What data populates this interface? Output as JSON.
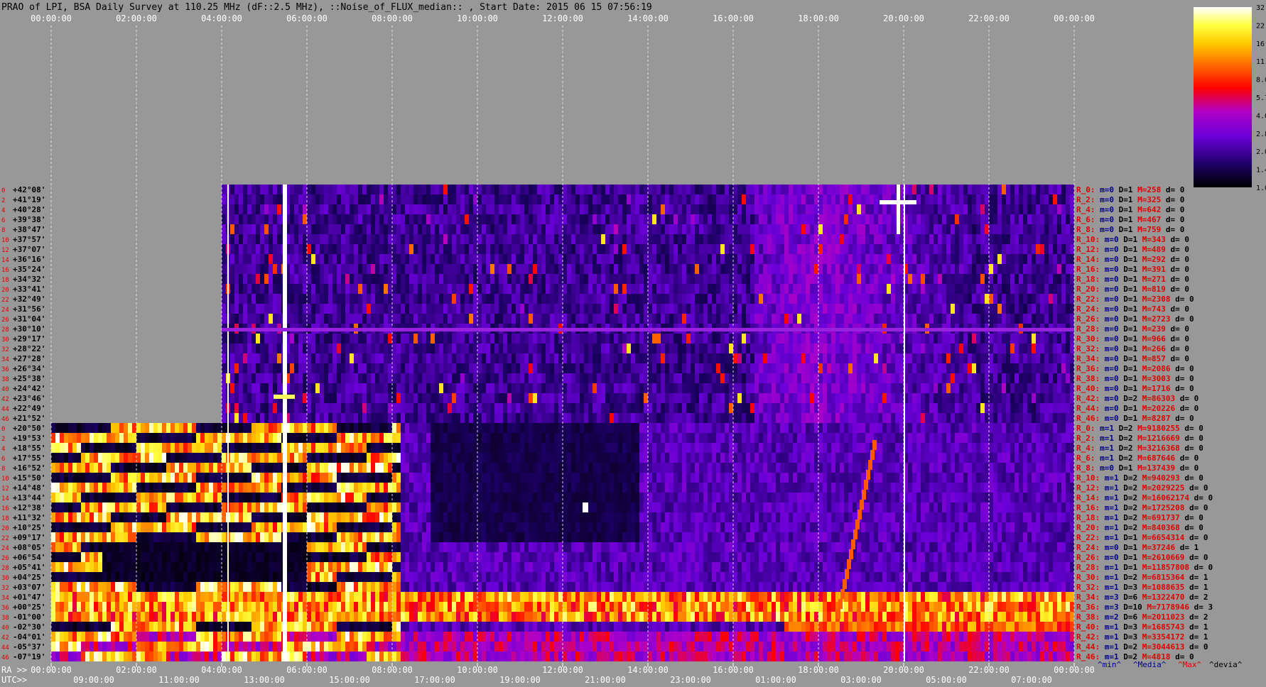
{
  "title": "PRAO of LPI, BSA Daily Survey at 110.25 MHz (dF::2.5 MHz), ::Noise_of_FLUX_median:: , Start Date: 2015 06 15 07:56:19",
  "colors": {
    "background": "#989898",
    "label_blue": "#00008b",
    "label_red": "#e00000",
    "label_black": "#000000"
  },
  "chart_data": {
    "type": "heatmap",
    "colormap": "gnuplot-like (black-blue-purple-red-orange-yellow-white)",
    "top_axis_ticks": [
      "00:00:00",
      "02:00:00",
      "04:00:00",
      "06:00:00",
      "08:00:00",
      "10:00:00",
      "12:00:00",
      "14:00:00",
      "16:00:00",
      "18:00:00",
      "20:00:00",
      "22:00:00",
      "00:00:00"
    ],
    "bottom_axis": {
      "ra_prefix": "RA >>",
      "ra_ticks": [
        "00:00:00",
        "02:00:00",
        "04:00:00",
        "06:00:00",
        "08:00:00",
        "10:00:00",
        "12:00:00",
        "14:00:00",
        "16:00:00",
        "18:00:00",
        "20:00:00",
        "22:00:00",
        "00:00:00"
      ],
      "utc_prefix": "UTC>>",
      "utc_ticks": [
        "09:00:00",
        "11:00:00",
        "13:00:00",
        "15:00:00",
        "17:00:00",
        "19:00:00",
        "21:00:00",
        "23:00:00",
        "01:00:00",
        "03:00:00",
        "05:00:00",
        "07:00:00"
      ]
    },
    "colorbar": {
      "ticks": [
        "32.0",
        "22.6",
        "16.0",
        "11.3",
        "8.0",
        "5.7",
        "4.0",
        "2.8",
        "2.0",
        "1.4",
        "1.0"
      ]
    },
    "declinations_upper": [
      "+42°08'",
      "+41°19'",
      "+40°28'",
      "+39°38'",
      "+38°47'",
      "+37°57'",
      "+37°07'",
      "+36°16'",
      "+35°24'",
      "+34°32'",
      "+33°41'",
      "+32°49'",
      "+31°56'",
      "+31°04'",
      "+30°10'",
      "+29°17'",
      "+28°22'",
      "+27°28'",
      "+26°34'",
      "+25°38'",
      "+24°42'",
      "+23°46'",
      "+22°49'",
      "+21°52'"
    ],
    "declinations_lower": [
      "+20°50'",
      "+19°53'",
      "+18°55'",
      "+17°55'",
      "+16°52'",
      "+15°50'",
      "+14°48'",
      "+13°44'",
      "+12°38'",
      "+11°32'",
      "+10°25'",
      "+09°17'",
      "+08°05'",
      "+06°54'",
      "+05°41'",
      "+04°25'",
      "+03°07'",
      "+01°47'",
      "+00°25'",
      "-01°00'",
      "-02°30'",
      "-04°01'",
      "-05°37'",
      "-07°19'"
    ],
    "row_index_labels": [
      "0",
      "2",
      "4",
      "6",
      "8",
      "10",
      "12",
      "14",
      "16",
      "18",
      "20",
      "22",
      "24",
      "26",
      "28",
      "30",
      "32",
      "34",
      "36",
      "38",
      "40",
      "42",
      "44",
      "46"
    ],
    "right_stats_upper": [
      {
        "r": "R_0:",
        "m": "m=0",
        "D": "D=1",
        "M": "M=258",
        "d": "d= 0"
      },
      {
        "r": "R_2:",
        "m": "m=0",
        "D": "D=1",
        "M": "M=325",
        "d": "d= 0"
      },
      {
        "r": "R_4:",
        "m": "m=0",
        "D": "D=1",
        "M": "M=642",
        "d": "d= 0"
      },
      {
        "r": "R_6:",
        "m": "m=0",
        "D": "D=1",
        "M": "M=467",
        "d": "d= 0"
      },
      {
        "r": "R_8:",
        "m": "m=0",
        "D": "D=1",
        "M": "M=759",
        "d": "d= 0"
      },
      {
        "r": "R_10:",
        "m": "m=0",
        "D": "D=1",
        "M": "M=343",
        "d": "d= 0"
      },
      {
        "r": "R_12:",
        "m": "m=0",
        "D": "D=1",
        "M": "M=489",
        "d": "d= 0"
      },
      {
        "r": "R_14:",
        "m": "m=0",
        "D": "D=1",
        "M": "M=292",
        "d": "d= 0"
      },
      {
        "r": "R_16:",
        "m": "m=0",
        "D": "D=1",
        "M": "M=391",
        "d": "d= 0"
      },
      {
        "r": "R_18:",
        "m": "m=0",
        "D": "D=1",
        "M": "M=271",
        "d": "d= 0"
      },
      {
        "r": "R_20:",
        "m": "m=0",
        "D": "D=1",
        "M": "M=819",
        "d": "d= 0"
      },
      {
        "r": "R_22:",
        "m": "m=0",
        "D": "D=1",
        "M": "M=2308",
        "d": "d= 0"
      },
      {
        "r": "R_24:",
        "m": "m=0",
        "D": "D=1",
        "M": "M=743",
        "d": "d= 0"
      },
      {
        "r": "R_26:",
        "m": "m=0",
        "D": "D=1",
        "M": "M=2723",
        "d": "d= 0"
      },
      {
        "r": "R_28:",
        "m": "m=0",
        "D": "D=1",
        "M": "M=239",
        "d": "d= 0"
      },
      {
        "r": "R_30:",
        "m": "m=0",
        "D": "D=1",
        "M": "M=966",
        "d": "d= 0"
      },
      {
        "r": "R_32:",
        "m": "m=0",
        "D": "D=1",
        "M": "M=266",
        "d": "d= 0"
      },
      {
        "r": "R_34:",
        "m": "m=0",
        "D": "D=1",
        "M": "M=857",
        "d": "d= 0"
      },
      {
        "r": "R_36:",
        "m": "m=0",
        "D": "D=1",
        "M": "M=2086",
        "d": "d= 0"
      },
      {
        "r": "R_38:",
        "m": "m=0",
        "D": "D=1",
        "M": "M=3003",
        "d": "d= 0"
      },
      {
        "r": "R_40:",
        "m": "m=0",
        "D": "D=1",
        "M": "M=1716",
        "d": "d= 0"
      },
      {
        "r": "R_42:",
        "m": "m=0",
        "D": "D=2",
        "M": "M=86303",
        "d": "d= 0"
      },
      {
        "r": "R_44:",
        "m": "m=0",
        "D": "D=1",
        "M": "M=20226",
        "d": "d= 0"
      },
      {
        "r": "R_46:",
        "m": "m=0",
        "D": "D=1",
        "M": "M=8287",
        "d": "d= 0"
      }
    ],
    "right_stats_lower": [
      {
        "r": "R_0:",
        "m": "m=1",
        "D": "D=2",
        "M": "M=9180255",
        "d": "d= 0"
      },
      {
        "r": "R_2:",
        "m": "m=1",
        "D": "D=2",
        "M": "M=1216669",
        "d": "d= 0"
      },
      {
        "r": "R_4:",
        "m": "m=1",
        "D": "D=2",
        "M": "M=3216368",
        "d": "d= 0"
      },
      {
        "r": "R_6:",
        "m": "m=1",
        "D": "D=2",
        "M": "M=687646",
        "d": "d= 0"
      },
      {
        "r": "R_8:",
        "m": "m=0",
        "D": "D=1",
        "M": "M=137439",
        "d": "d= 0"
      },
      {
        "r": "R_10:",
        "m": "m=1",
        "D": "D=2",
        "M": "M=940293",
        "d": "d= 0"
      },
      {
        "r": "R_12:",
        "m": "m=1",
        "D": "D=2",
        "M": "M=2029225",
        "d": "d= 0"
      },
      {
        "r": "R_14:",
        "m": "m=1",
        "D": "D=2",
        "M": "M=16062174",
        "d": "d= 0"
      },
      {
        "r": "R_16:",
        "m": "m=1",
        "D": "D=2",
        "M": "M=1725208",
        "d": "d= 0"
      },
      {
        "r": "R_18:",
        "m": "m=1",
        "D": "D=2",
        "M": "M=691737",
        "d": "d= 0"
      },
      {
        "r": "R_20:",
        "m": "m=1",
        "D": "D=2",
        "M": "M=840368",
        "d": "d= 0"
      },
      {
        "r": "R_22:",
        "m": "m=1",
        "D": "D=1",
        "M": "M=6654314",
        "d": "d= 0"
      },
      {
        "r": "R_24:",
        "m": "m=0",
        "D": "D=1",
        "M": "M=37246",
        "d": "d= 1"
      },
      {
        "r": "R_26:",
        "m": "m=0",
        "D": "D=1",
        "M": "M=2610669",
        "d": "d= 0"
      },
      {
        "r": "R_28:",
        "m": "m=1",
        "D": "D=1",
        "M": "M=11857808",
        "d": "d= 0"
      },
      {
        "r": "R_30:",
        "m": "m=1",
        "D": "D=2",
        "M": "M=6815364",
        "d": "d= 1"
      },
      {
        "r": "R_32:",
        "m": "m=1",
        "D": "D=3",
        "M": "M=1088635",
        "d": "d= 1"
      },
      {
        "r": "R_34:",
        "m": "m=3",
        "D": "D=6",
        "M": "M=1322470",
        "d": "d= 2"
      },
      {
        "r": "R_36:",
        "m": "m=3",
        "D": "D=10",
        "M": "M=7178946",
        "d": "d= 3"
      },
      {
        "r": "R_38:",
        "m": "m=2",
        "D": "D=6",
        "M": "M=2011023",
        "d": "d= 2"
      },
      {
        "r": "R_40:",
        "m": "m=1",
        "D": "D=3",
        "M": "M=1685743",
        "d": "d= 1"
      },
      {
        "r": "R_42:",
        "m": "m=1",
        "D": "D=3",
        "M": "M=3354172",
        "d": "d= 1"
      },
      {
        "r": "R_44:",
        "m": "m=1",
        "D": "D=2",
        "M": "M=3044613",
        "d": "d= 0"
      },
      {
        "r": "R_46:",
        "m": "m=1",
        "D": "D=2",
        "M": "M=4818",
        "d": "d= 0"
      }
    ],
    "footer_legend": [
      "^min^",
      "^Media^",
      "^Max^",
      "^devia^"
    ]
  }
}
